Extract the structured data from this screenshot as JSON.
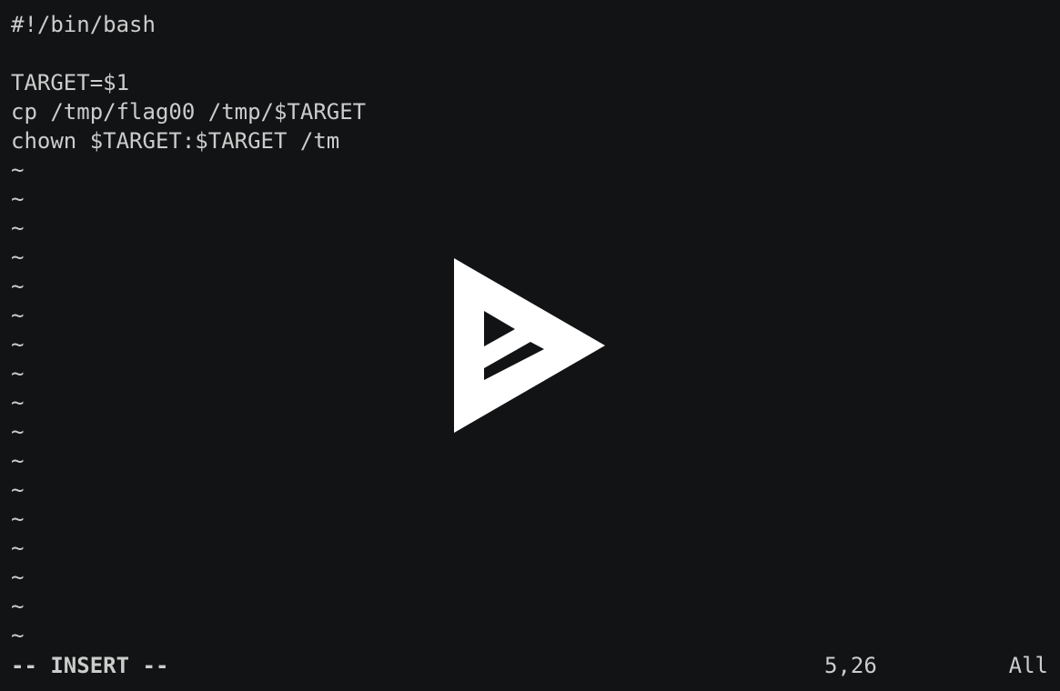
{
  "editor": {
    "lines": [
      "#!/bin/bash",
      "",
      "TARGET=$1",
      "cp /tmp/flag00 /tmp/$TARGET",
      "chown $TARGET:$TARGET /tm"
    ],
    "empty_marker": "~"
  },
  "statusline": {
    "mode": "-- INSERT --",
    "position": "5,26",
    "scroll": "All"
  },
  "overlay": {
    "icon": "asciinema-play-icon",
    "color": "#ffffff"
  },
  "colors": {
    "background": "#121314",
    "foreground": "#cccccc"
  }
}
